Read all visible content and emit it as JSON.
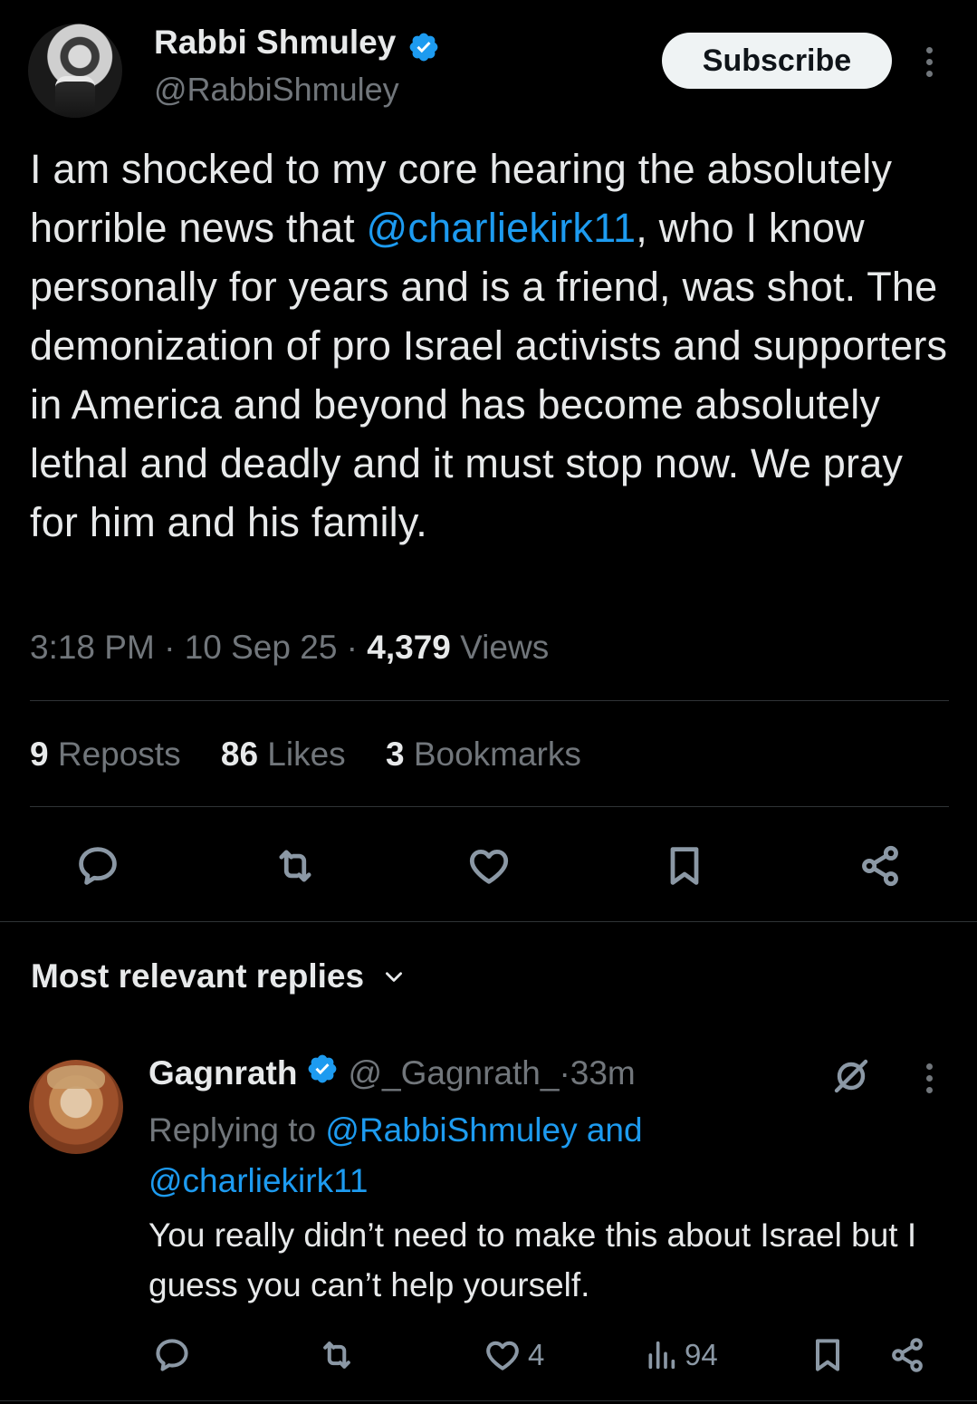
{
  "tweet": {
    "author_name": "Rabbi Shmuley",
    "author_handle": "@RabbiShmuley",
    "subscribe_label": "Subscribe",
    "text_part1": "I am shocked to my core hearing the absolutely horrible news that ",
    "mention": "@charliekirk11",
    "text_part2": ", who I know personally for years and is a friend, was shot. The demonization of pro Israel activists and supporters in America and beyond has become absolutely lethal and deadly and it must stop now. We pray for him and his family.",
    "time": "3:18 PM",
    "sep1": " · ",
    "date": "10 Sep 25",
    "sep2": " · ",
    "views_count": "4,379",
    "views_label": " Views",
    "reposts_count": "9",
    "reposts_label": " Reposts",
    "likes_count": "86",
    "likes_label": " Likes",
    "bookmarks_count": "3",
    "bookmarks_label": " Bookmarks",
    "actions": [
      "reply-icon",
      "repost-icon",
      "like-icon",
      "bookmark-icon",
      "share-icon"
    ]
  },
  "replies": {
    "sort_label": "Most relevant replies",
    "items": [
      {
        "name": "Gagnrath",
        "handle": "@_Gagnrath_",
        "sep": " · ",
        "time": "33m",
        "replying_prefix": "Replying to ",
        "replying_to_1": "@RabbiShmuley",
        "replying_and": " and",
        "replying_to_2": "@charliekirk11",
        "text": "You really didn’t need to make this about Israel but I guess you can’t help yourself.",
        "likes": "4",
        "views": "94"
      }
    ]
  },
  "colors": {
    "background": "#000000",
    "text": "#e7e9ea",
    "muted": "#71767b",
    "link": "#1d9bf0",
    "verified": "#1d9bf0"
  }
}
